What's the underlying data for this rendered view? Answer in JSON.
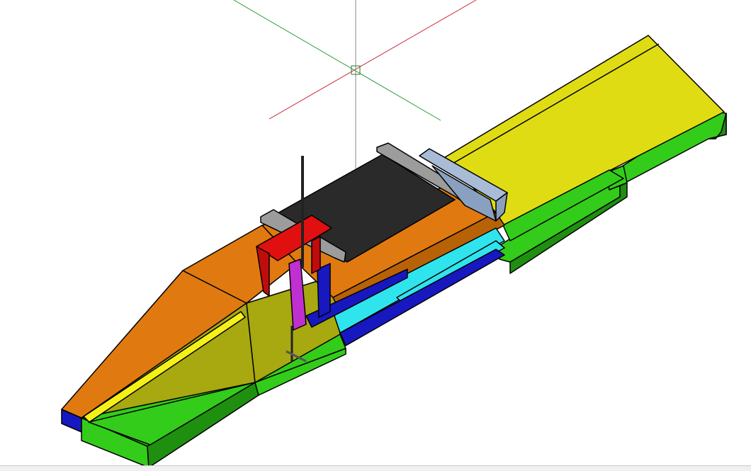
{
  "viewport": {
    "background": "#ffffff",
    "crosshair_colors": {
      "x_axis": "#c8283c",
      "y_axis": "#2a9a3a",
      "z_axis": "#8a8a8a"
    }
  },
  "model": {
    "part_colors": {
      "base_green": "#33cc1a",
      "base_green_dark": "#1f8f10",
      "chute_yellow": "#e0dc14",
      "chute_yellow_dark": "#b4b00e",
      "funnel_orange": "#e07a10",
      "funnel_orange_dark": "#b86208",
      "funnel_olive": "#a8a810",
      "bed_black": "#2a2a2a",
      "rail_grey": "#9c9c9c",
      "guide_lightblue": "#a8bcd8",
      "channel_cyan": "#30e4ee",
      "channel_blue": "#1818c0",
      "clamp_red": "#e01010",
      "post_magenta": "#c030d0",
      "stripe_yellow": "#f4f018"
    }
  }
}
